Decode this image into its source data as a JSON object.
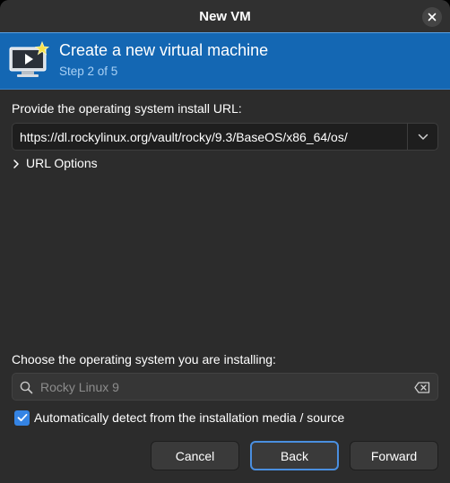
{
  "window": {
    "title": "New VM"
  },
  "header": {
    "title": "Create a new virtual machine",
    "step": "Step 2 of 5"
  },
  "install_url": {
    "label": "Provide the operating system install URL:",
    "value": "https://dl.rockylinux.org/vault/rocky/9.3/BaseOS/x86_64/os/"
  },
  "url_options": {
    "label": "URL Options",
    "expanded": false
  },
  "os_choice": {
    "label": "Choose the operating system you are installing:",
    "placeholder": "Rocky Linux 9"
  },
  "autodetect": {
    "label": "Automatically detect from the installation media / source",
    "checked": true
  },
  "buttons": {
    "cancel": "Cancel",
    "back": "Back",
    "forward": "Forward"
  },
  "icons": {
    "close": "close-icon",
    "vm": "virtual-machine-icon",
    "dropdown": "chevron-down-icon",
    "expander": "chevron-right-icon",
    "search": "search-icon",
    "clear": "clear-text-icon",
    "check": "checkmark-icon"
  },
  "colors": {
    "accent": "#3584e4",
    "banner": "#1467b3",
    "background": "#2c2c2c"
  }
}
